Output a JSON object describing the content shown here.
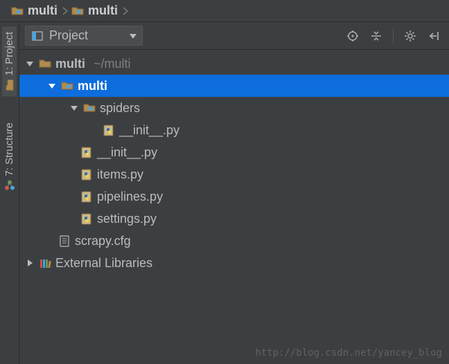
{
  "breadcrumb": [
    {
      "label": "multi",
      "icon": "folder-dot"
    },
    {
      "label": "multi",
      "icon": "folder-dot"
    }
  ],
  "gutter": {
    "project": "1: Project",
    "structure": "7: Structure"
  },
  "toolbar": {
    "view_label": "Project"
  },
  "tree": {
    "root": {
      "name": "multi",
      "path": "~/multi",
      "children": {
        "pkg": {
          "name": "multi",
          "spiders": {
            "name": "spiders",
            "init": "__init__.py"
          },
          "init": "__init__.py",
          "items": "items.py",
          "pipelines": "pipelines.py",
          "settings": "settings.py"
        },
        "cfg": "scrapy.cfg"
      }
    },
    "ext_libs": "External Libraries"
  },
  "watermark": "http://blog.csdn.net/yancey_blog"
}
